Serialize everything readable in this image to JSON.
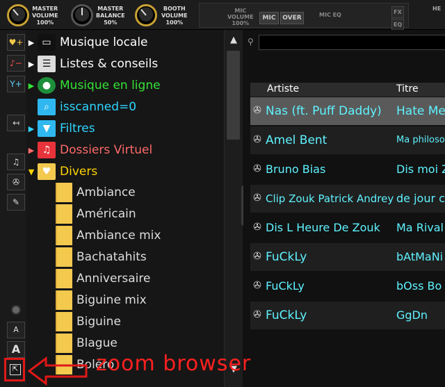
{
  "mixer": {
    "knobs": [
      {
        "label": "MASTER\nVOLUME",
        "value": "100%"
      },
      {
        "label": "MASTER\nBALANCE",
        "value": "50%"
      },
      {
        "label": "BOOTH\nVOLUME",
        "value": "100%"
      }
    ],
    "mic": {
      "volume_label": "MIC\nVOLUME",
      "volume_value": "100%",
      "mic_button": "MIC",
      "over_button": "OVER",
      "eq_label": "MIC EQ",
      "fx": "FX",
      "eq": "EQ",
      "hp_label": "HE"
    }
  },
  "tree": {
    "items": [
      {
        "label": "Musique locale",
        "color": "#ffffff",
        "arrow_color": "#ffffff",
        "icon": "computer-icon"
      },
      {
        "label": "Listes & conseils",
        "color": "#ffffff",
        "arrow_color": "#ffffff",
        "icon": "list-icon"
      },
      {
        "label": "Musique en ligne",
        "color": "#35e335",
        "arrow_color": "#35e335",
        "icon": "globe-icon"
      },
      {
        "label": "isscanned=0",
        "color": "#2fd5ff",
        "arrow_color": "",
        "icon": "search-folder-icon"
      },
      {
        "label": "Filtres",
        "color": "#2fd5ff",
        "arrow_color": "#2fd5ff",
        "icon": "filter-icon"
      },
      {
        "label": "Dossiers Virtuel",
        "color": "#ff6a6a",
        "arrow_color": "#ff6a6a",
        "icon": "virtual-folder-icon"
      },
      {
        "label": "Divers",
        "color": "#ffd400",
        "arrow_color": "#ffd400",
        "icon": "heart-folder-icon"
      }
    ],
    "subitems": [
      "Ambiance",
      "Américain",
      "Ambiance mix",
      "Bachatahits",
      "Anniversaire",
      "Biguine mix",
      "Biguine",
      "Blague",
      "Boléro"
    ]
  },
  "folders_tab": "folders",
  "browser": {
    "search_placeholder": "",
    "columns": [
      "Artiste",
      "Titre"
    ],
    "rows": [
      {
        "artist": "Nas (ft. Puff Daddy)",
        "title": "Hate Me"
      },
      {
        "artist": "Amel Bent",
        "title": "Ma philosophie"
      },
      {
        "artist": "Bruno Bias",
        "title": "Dis moi Z"
      },
      {
        "artist": "Clip Zouk Patrick Andrey",
        "title": "de jour c"
      },
      {
        "artist": "Dis L Heure De Zouk",
        "title": "Ma Rival"
      },
      {
        "artist": "FuCkLy",
        "title": "bAtMaNi"
      },
      {
        "artist": "FuCkLy",
        "title": "bOss Bo"
      },
      {
        "artist": "FuCkLy",
        "title": "GgDn"
      }
    ]
  },
  "annotation": {
    "text": "zoom browser",
    "color": "#ff2020"
  },
  "side_tools": {
    "font_small": "A",
    "font_large": "A"
  }
}
